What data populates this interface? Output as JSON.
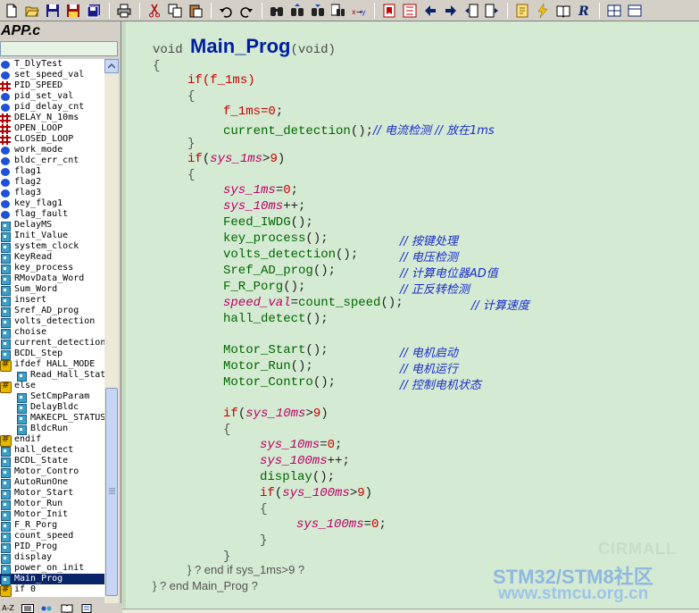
{
  "file_title": "APP.c",
  "symbols": [
    {
      "label": "T_DlyTest",
      "icon": "variable-icon",
      "level": 0
    },
    {
      "label": "set_speed_val",
      "icon": "variable-icon",
      "level": 0
    },
    {
      "label": "PID_SPEED",
      "icon": "define-icon",
      "level": 0
    },
    {
      "label": "pid_set_val",
      "icon": "variable-icon",
      "level": 0
    },
    {
      "label": "pid_delay_cnt",
      "icon": "variable-icon",
      "level": 0
    },
    {
      "label": "DELAY_N_10ms",
      "icon": "define-icon",
      "level": 0
    },
    {
      "label": "OPEN_LOOP",
      "icon": "define-icon",
      "level": 0
    },
    {
      "label": "CLOSED_LOOP",
      "icon": "define-icon",
      "level": 0
    },
    {
      "label": "work_mode",
      "icon": "variable-icon",
      "level": 0
    },
    {
      "label": "bldc_err_cnt",
      "icon": "variable-icon",
      "level": 0
    },
    {
      "label": "flag1",
      "icon": "variable-icon",
      "level": 0
    },
    {
      "label": "flag2",
      "icon": "variable-icon",
      "level": 0
    },
    {
      "label": "flag3",
      "icon": "variable-icon",
      "level": 0
    },
    {
      "label": "key_flag1",
      "icon": "variable-icon",
      "level": 0
    },
    {
      "label": "flag_fault",
      "icon": "variable-icon",
      "level": 0
    },
    {
      "label": "DelayMS",
      "icon": "function-icon",
      "level": 0
    },
    {
      "label": "Init_Value",
      "icon": "function-icon",
      "level": 0
    },
    {
      "label": "system_clock",
      "icon": "function-icon",
      "level": 0
    },
    {
      "label": "KeyRead",
      "icon": "function-icon",
      "level": 0
    },
    {
      "label": "key_process",
      "icon": "function-icon",
      "level": 0
    },
    {
      "label": "RMovData_Word",
      "icon": "function-icon",
      "level": 0
    },
    {
      "label": "Sum_Word",
      "icon": "function-icon",
      "level": 0
    },
    {
      "label": "insert",
      "icon": "function-icon",
      "level": 0
    },
    {
      "label": "Sref_AD_prog",
      "icon": "function-icon",
      "level": 0
    },
    {
      "label": "volts_detection",
      "icon": "function-icon",
      "level": 0
    },
    {
      "label": "choise",
      "icon": "function-icon",
      "level": 0
    },
    {
      "label": "current_detection",
      "icon": "function-icon",
      "level": 0
    },
    {
      "label": "BCDL_Step",
      "icon": "function-icon",
      "level": 0
    },
    {
      "label": "ifdef HALL_MODE",
      "icon": "conditional-icon",
      "level": 0
    },
    {
      "label": "Read_Hall_Stat",
      "icon": "function-icon",
      "level": 1
    },
    {
      "label": "else",
      "icon": "conditional-icon",
      "level": 0
    },
    {
      "label": "SetCmpParam",
      "icon": "function-icon",
      "level": 1
    },
    {
      "label": "DelayBldc",
      "icon": "function-icon",
      "level": 1
    },
    {
      "label": "MAKECPL_STATUS",
      "icon": "function-icon",
      "level": 1
    },
    {
      "label": "BldcRun",
      "icon": "function-icon",
      "level": 1
    },
    {
      "label": "endif",
      "icon": "conditional-icon",
      "level": 0
    },
    {
      "label": "hall_detect",
      "icon": "function-icon",
      "level": 0
    },
    {
      "label": "BCDL_State",
      "icon": "function-icon",
      "level": 0
    },
    {
      "label": "Motor_Contro",
      "icon": "function-icon",
      "level": 0
    },
    {
      "label": "AutoRunOne",
      "icon": "function-icon",
      "level": 0
    },
    {
      "label": "Motor_Start",
      "icon": "function-icon",
      "level": 0
    },
    {
      "label": "Motor_Run",
      "icon": "function-icon",
      "level": 0
    },
    {
      "label": "Motor_Init",
      "icon": "function-icon",
      "level": 0
    },
    {
      "label": "F_R_Porg",
      "icon": "function-icon",
      "level": 0
    },
    {
      "label": "count_speed",
      "icon": "function-icon",
      "level": 0
    },
    {
      "label": "PID_Prog",
      "icon": "function-icon",
      "level": 0
    },
    {
      "label": "display",
      "icon": "function-icon",
      "level": 0
    },
    {
      "label": "power_on_init",
      "icon": "function-icon",
      "level": 0
    },
    {
      "label": "Main_Prog",
      "icon": "function-icon",
      "level": 0,
      "selected": true
    },
    {
      "label": "if 0",
      "icon": "conditional-icon",
      "level": 0
    }
  ],
  "tabbar": {
    "tab_az": "A-Z"
  },
  "code": {
    "l1": {
      "kw": "void",
      "name": "Main_Prog",
      "params": "(void)"
    },
    "l2": "{",
    "l3": {
      "kw": "if",
      "open": "(",
      "cond": "f_1ms",
      "close": ")"
    },
    "l4": "{",
    "l5": {
      "var": "f_1ms",
      "op": "=",
      "num": "0",
      "end": ";"
    },
    "l6": {
      "fn": "current_detection",
      "args": "();",
      "cmt": "// 电流检测 // 放在1ms"
    },
    "l7": "}",
    "l8": {
      "kw": "if",
      "open": "(",
      "var": "sys_1ms",
      "op": ">",
      "num": "9",
      "close": ")"
    },
    "l9": "{",
    "l10": {
      "var": "sys_1ms",
      "op": "=",
      "num": "0",
      "end": ";"
    },
    "l11": {
      "var": "sys_10ms",
      "op": "++",
      "end": ";"
    },
    "l12": {
      "fn": "Feed_IWDG",
      "args": "();"
    },
    "l13": {
      "fn": "key_process",
      "args": "();",
      "cmt": "// 按键处理"
    },
    "l14": {
      "fn": "volts_detection",
      "args": "();",
      "cmt": "// 电压检测"
    },
    "l15": {
      "fn": "Sref_AD_prog",
      "args": "();",
      "cmt": "// 计算电位器AD值"
    },
    "l16": {
      "fn": "F_R_Porg",
      "args": "();",
      "cmt": "// 正反转检测"
    },
    "l17": {
      "var": "speed_val",
      "op": "=",
      "fn": "count_speed",
      "args": "();",
      "cmt": "// 计算速度"
    },
    "l18": {
      "fn": "hall_detect",
      "args": "();"
    },
    "l19": {
      "fn": "Motor_Start",
      "args": "();",
      "cmt": "// 电机启动"
    },
    "l20": {
      "fn": "Motor_Run",
      "args": "();",
      "cmt": "// 电机运行"
    },
    "l21": {
      "fn": "Motor_Contro",
      "args": "();",
      "cmt": "// 控制电机状态"
    },
    "l22": {
      "kw": "if",
      "open": "(",
      "var": "sys_10ms",
      "op": ">",
      "num": "9",
      "close": ")"
    },
    "l23": "{",
    "l24": {
      "var": "sys_10ms",
      "op": "=",
      "num": "0",
      "end": ";"
    },
    "l25": {
      "var": "sys_100ms",
      "op": "++",
      "end": ";"
    },
    "l26": {
      "fn": "display",
      "args": "();"
    },
    "l27": {
      "kw": "if",
      "open": "(",
      "var": "sys_100ms",
      "op": ">",
      "num": "9",
      "close": ")"
    },
    "l28": "{",
    "l29": {
      "var": "sys_100ms",
      "op": "=",
      "num": "0",
      "end": ";"
    },
    "l30": "}",
    "l31": "}",
    "l32": "} ? end if sys_1ms>9 ?",
    "l33": "} ? end Main_Prog ?"
  },
  "watermark": {
    "line0": "CIRMALL",
    "line1": "STM32/STM8社区",
    "line2": "www.stmcu.org.cn"
  },
  "colors": {
    "editor_bg": "#d4ead2",
    "keyword": "#cc0000",
    "function": "#006600",
    "variable": "#bb0066",
    "comment": "#1a2ecc",
    "selection": "#0a246a"
  }
}
